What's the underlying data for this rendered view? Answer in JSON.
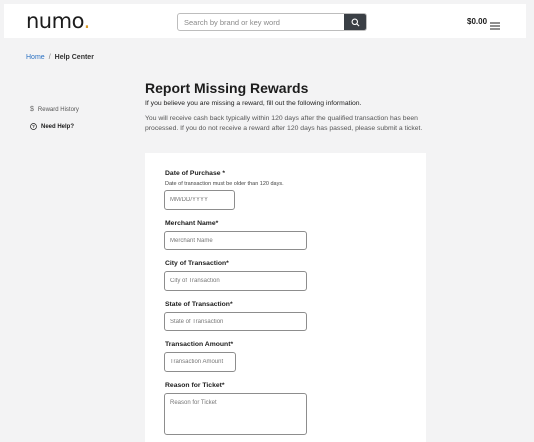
{
  "header": {
    "logo_text": "numo",
    "logo_dot": ".",
    "search_placeholder": "Search by brand or key word",
    "balance": "$0.00"
  },
  "breadcrumb": {
    "home": "Home",
    "separator": "/",
    "current": "Help Center"
  },
  "sidebar": {
    "items": [
      {
        "label": "Reward History",
        "icon": "dollar-icon"
      },
      {
        "label": "Need Help?",
        "icon": "help-circle-icon"
      }
    ]
  },
  "page": {
    "title": "Report Missing Rewards",
    "subtitle": "If you believe you are missing a reward, fill out the following information.",
    "description": "You will receive cash back typically within 120 days after the qualified transaction has been processed. If you do not receive a reward after 120 days has passed, please submit a ticket."
  },
  "form": {
    "date_label": "Date of Purchase *",
    "date_hint": "Date of transaction must be older than 120 days.",
    "date_placeholder": "MM/DD/YYYY",
    "merchant_label": "Merchant Name*",
    "merchant_placeholder": "Merchant Name",
    "city_label": "City of Transaction*",
    "city_placeholder": "City of Transaction",
    "state_label": "State of Transaction*",
    "state_placeholder": "State of Transaction",
    "amount_label": "Transaction Amount*",
    "amount_placeholder": "Transaction Amount",
    "reason_label": "Reason for Ticket*",
    "reason_placeholder": "Reason for Ticket"
  },
  "colors": {
    "accent_link": "#2a70c2",
    "logo_dot": "#d99a2b",
    "search_button": "#3a3f45"
  }
}
